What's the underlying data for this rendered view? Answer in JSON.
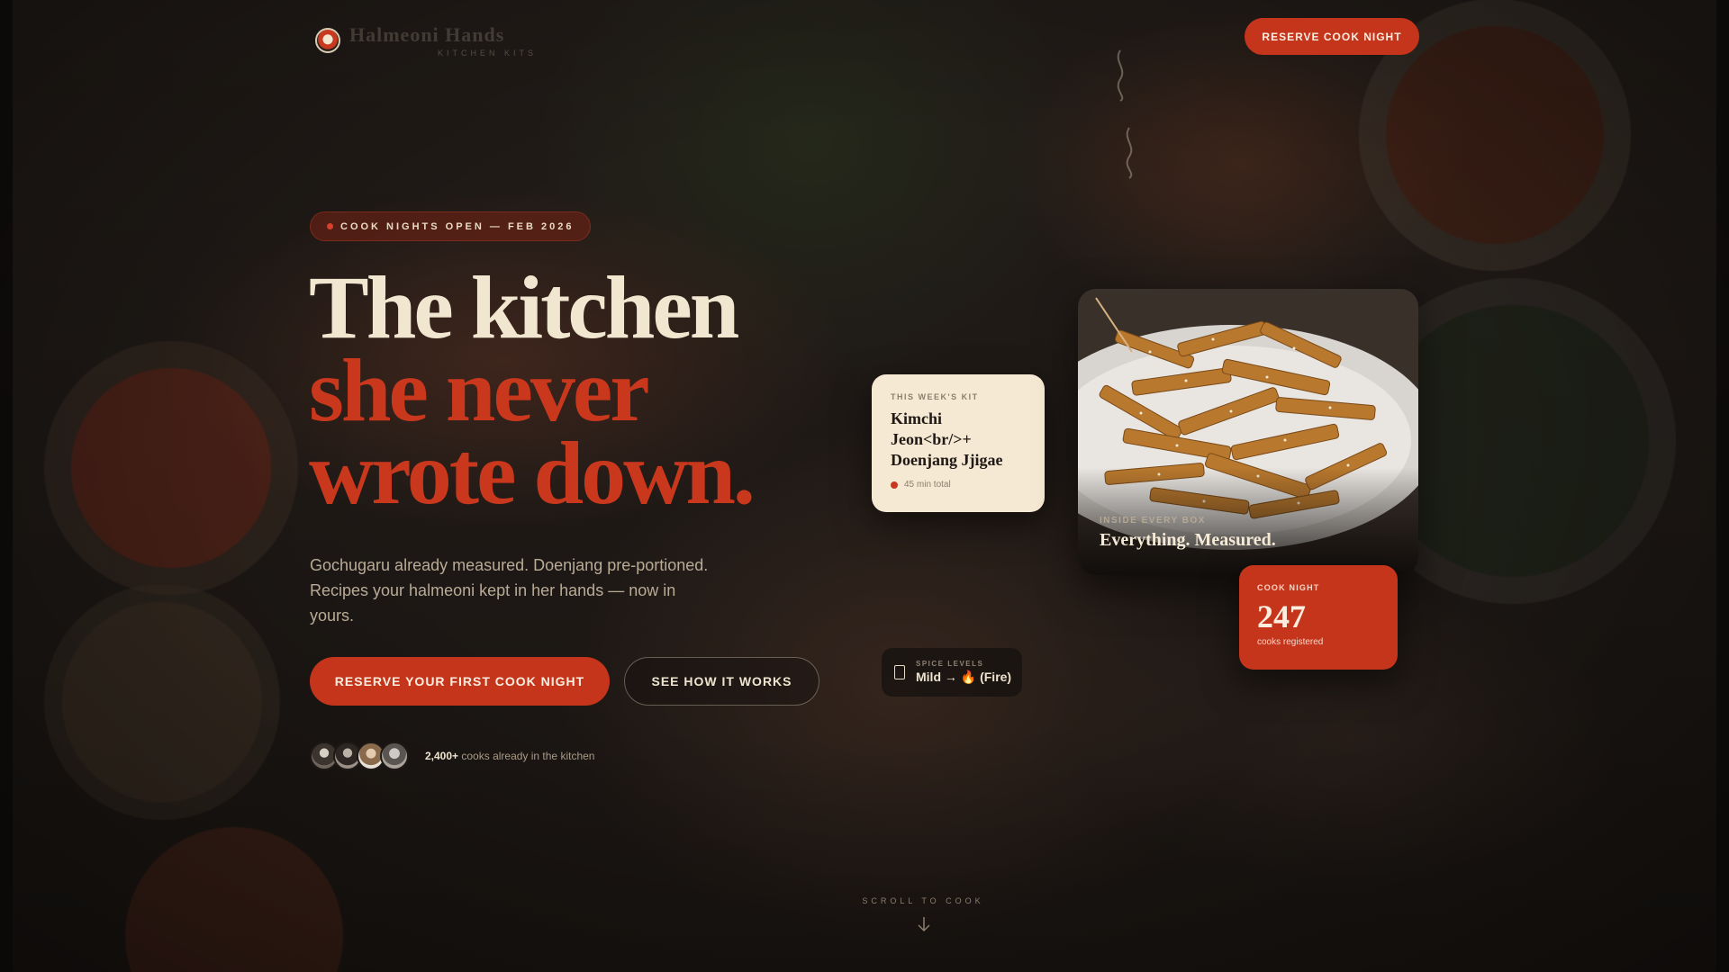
{
  "header": {
    "brand_name": "Halmeoni Hands",
    "brand_tag": "KITCHEN KITS",
    "cta_label": "RESERVE COOK NIGHT"
  },
  "hero": {
    "eyebrow": "COOK NIGHTS OPEN — FEB 2026",
    "headline_line1": "The kitchen",
    "headline_line2": "she never",
    "headline_line3": "wrote down.",
    "lede": "Gochugaru already measured. Doenjang pre-portioned. Recipes your halmeoni kept in her hands — now in yours.",
    "primary_cta": "RESERVE YOUR FIRST COOK NIGHT",
    "secondary_cta": "SEE HOW IT WORKS",
    "social_count": "2,400+",
    "social_text": " cooks already in the kitchen"
  },
  "kit_card": {
    "label": "THIS WEEK'S KIT",
    "title": "Kimchi Jeon<br/>+ Doenjang Jjigae",
    "meta": "45 min total"
  },
  "photo_card": {
    "label": "INSIDE EVERY BOX",
    "title": "Everything. Measured."
  },
  "count_card": {
    "label": "COOK NIGHT",
    "value": "247",
    "sub": "cooks registered"
  },
  "spice_chip": {
    "label": "SPICE LEVELS",
    "value": "Mild → 🔥 (Fire)"
  },
  "scroll_hint": "SCROLL TO COOK",
  "colors": {
    "accent": "#c5351c",
    "cream": "#f5e9d3",
    "background": "#1c1714"
  },
  "icons": [
    "logo-mark",
    "steam-squiggle",
    "status-dot",
    "spice-box-icon",
    "arrow-down-icon"
  ]
}
